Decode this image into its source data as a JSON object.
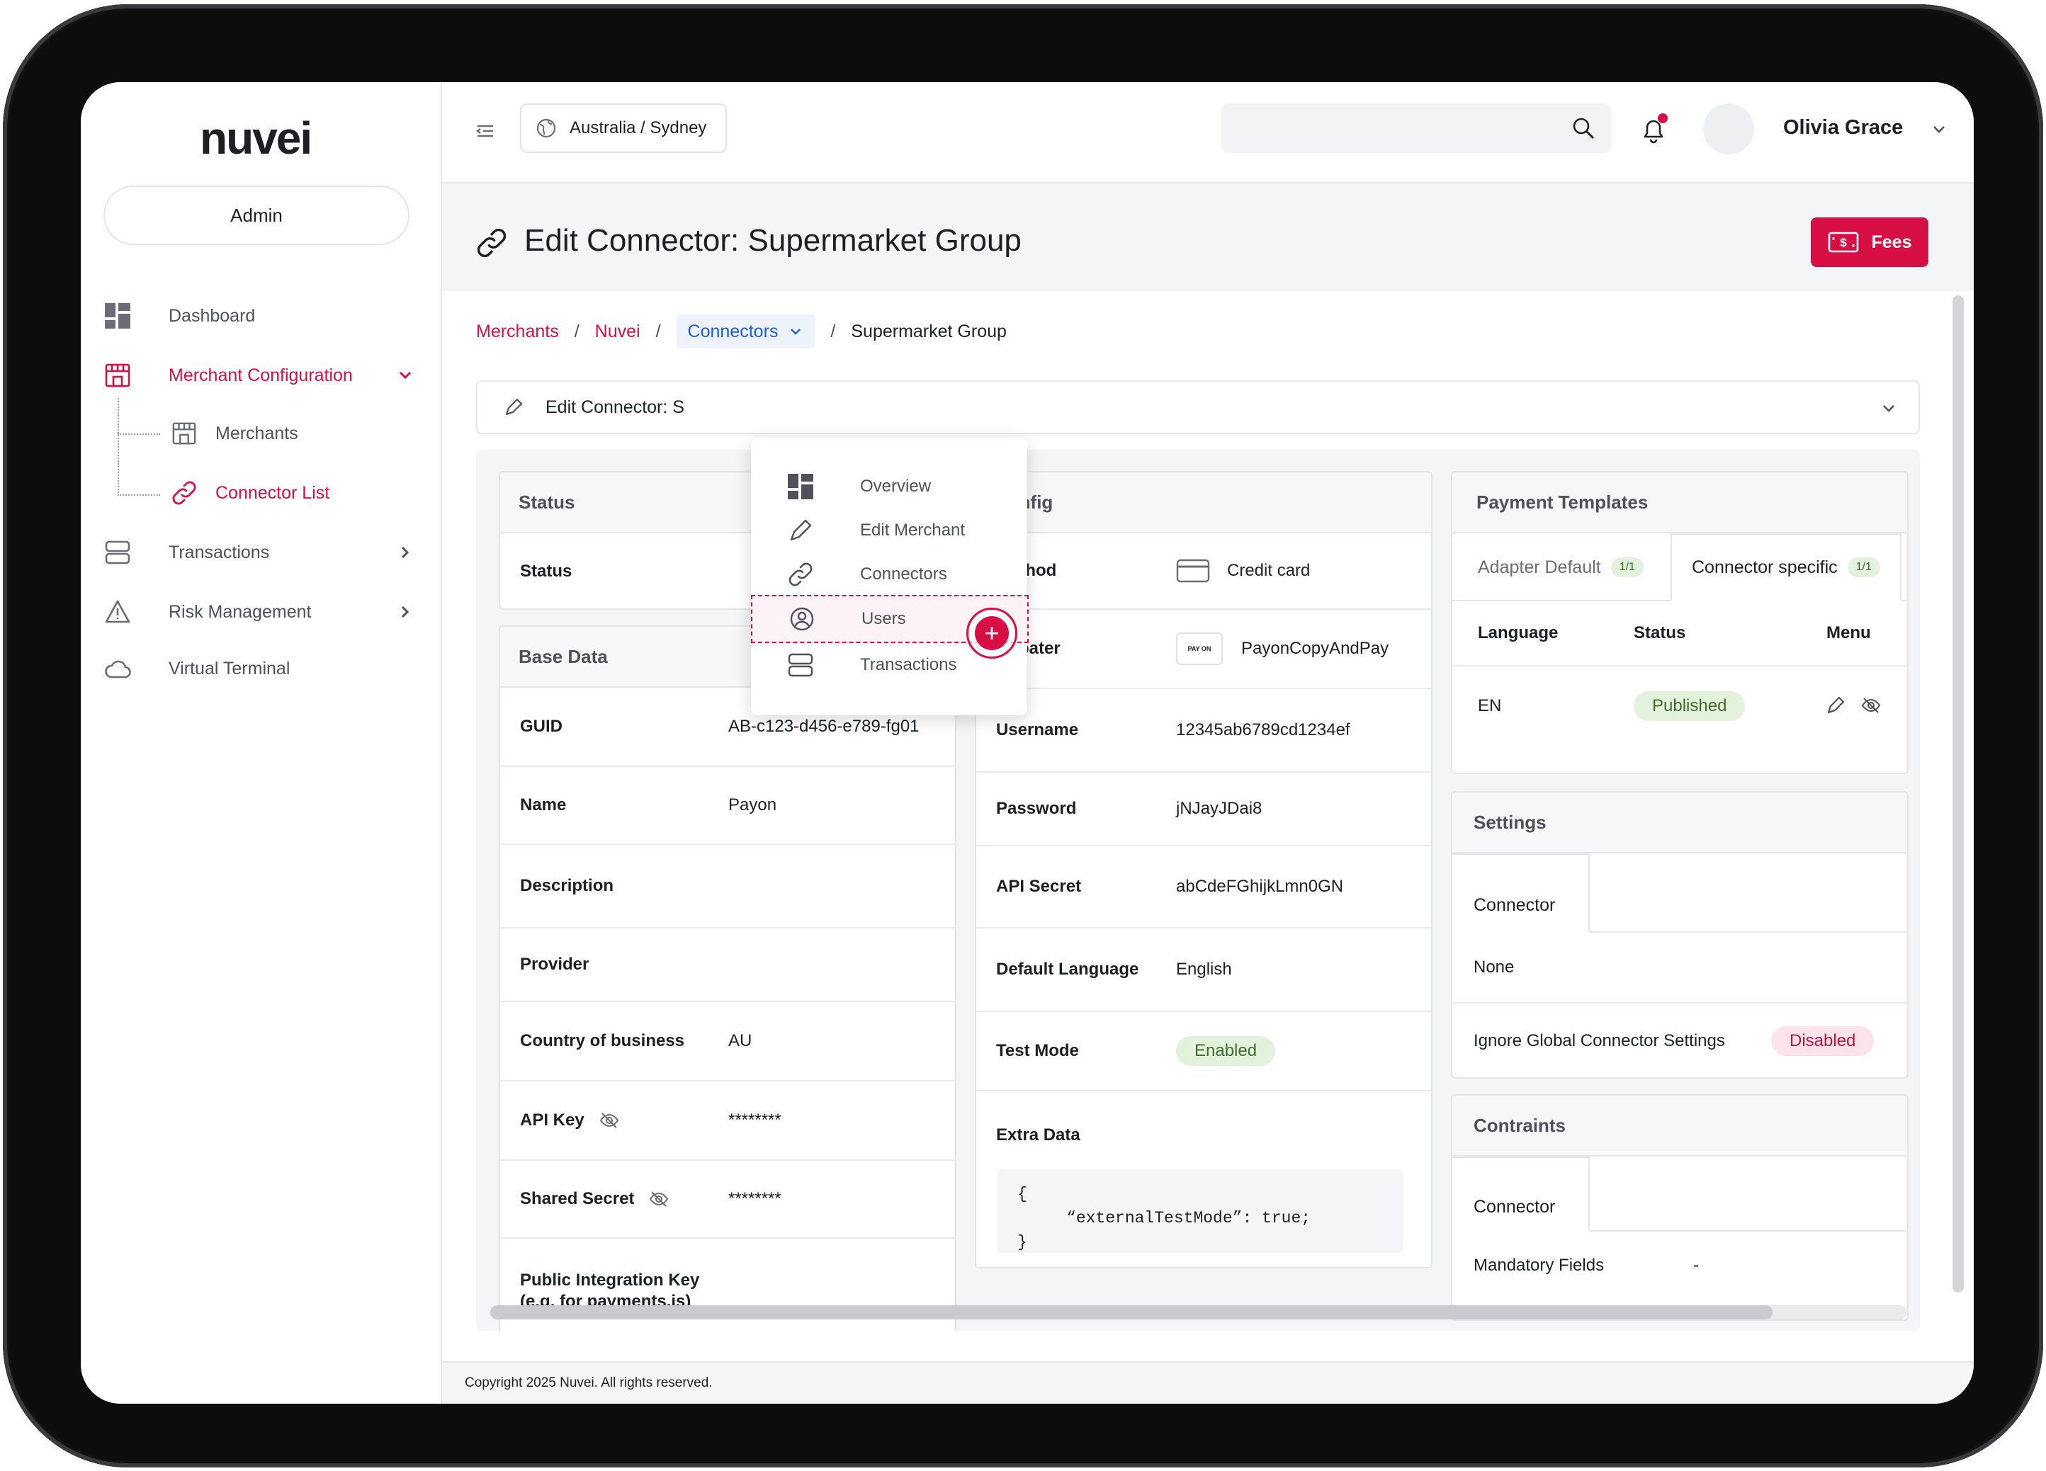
{
  "brand": {
    "logo": "nuvei",
    "accent": "#d80f45"
  },
  "sidebar": {
    "admin_label": "Admin",
    "items": [
      {
        "label": "Dashboard",
        "icon": "dashboard-icon"
      },
      {
        "label": "Merchant Configuration",
        "icon": "store-icon"
      },
      {
        "label": "Transactions",
        "icon": "layers-icon"
      },
      {
        "label": "Risk Management",
        "icon": "warning-icon"
      },
      {
        "label": "Virtual Terminal",
        "icon": "cloud-icon"
      }
    ],
    "sub_items": [
      {
        "label": "Merchants",
        "icon": "store-icon"
      },
      {
        "label": "Connector List",
        "icon": "link-icon"
      }
    ]
  },
  "topbar": {
    "timezone": "Australia / Sydney",
    "search_placeholder": "",
    "user_name": "Olivia Grace"
  },
  "page": {
    "title": "Edit Connector: Supermarket Group",
    "fees_label": "Fees"
  },
  "breadcrumb": {
    "merchants": "Merchants",
    "nuvei": "Nuvei",
    "connectors": "Connectors",
    "current": "Supermarket Group",
    "sep": "/"
  },
  "accordion": {
    "label": "Edit Connector: S"
  },
  "dropdown": {
    "items": [
      "Overview",
      "Edit Merchant",
      "Connectors",
      "Users",
      "Transactions"
    ]
  },
  "status_card": {
    "title": "Status",
    "status_label": "Status"
  },
  "base_data": {
    "title": "Base Data",
    "rows": [
      {
        "label": "GUID",
        "value": "AB-c123-d456-e789-fg01"
      },
      {
        "label": "Name",
        "value": "Payon"
      },
      {
        "label": "Description",
        "value": ""
      },
      {
        "label": "Provider",
        "value": ""
      },
      {
        "label": "Country of business",
        "value": "AU"
      },
      {
        "label": "API Key",
        "value": "********"
      },
      {
        "label": "Shared Secret",
        "value": "********"
      },
      {
        "label": "Public Integration Key",
        "value": ""
      }
    ],
    "cut_off_hint": "(e.g. for payments.js)"
  },
  "config": {
    "title": "Config",
    "rows": [
      {
        "label": "Method",
        "value": "Credit card"
      },
      {
        "label": "Adpater",
        "value": "PayonCopyAndPay",
        "logo_text": "PAY ON"
      },
      {
        "label": "Username",
        "value": "12345ab6789cd1234ef"
      },
      {
        "label": "Password",
        "value": "jNJayJDai8"
      },
      {
        "label": "API Secret",
        "value": "abCdeFGhijkLmn0GN"
      },
      {
        "label": "Default Language",
        "value": "English"
      },
      {
        "label": "Test Mode",
        "value": "Enabled"
      }
    ],
    "extra_data_label": "Extra Data",
    "extra_data_code": "{\n     “externalTestMode”: true;\n}"
  },
  "payment_templates": {
    "title": "Payment Templates",
    "tabs": [
      {
        "label": "Adapter Default",
        "badge": "1/1"
      },
      {
        "label": "Connector specific",
        "badge": "1/1"
      }
    ],
    "columns": [
      "Language",
      "Status",
      "Menu"
    ],
    "rows": [
      {
        "language": "EN",
        "status": "Published"
      }
    ]
  },
  "settings": {
    "title": "Settings",
    "tab": "Connector",
    "value": "None",
    "ignore_label": "Ignore Global Connector Settings",
    "ignore_status": "Disabled"
  },
  "constraints": {
    "title": "Contraints",
    "tab": "Connector",
    "mandatory_label": "Mandatory Fields",
    "mandatory_value": "-"
  },
  "footer": {
    "copyright": "Copyright 2025 Nuvei. All rights reserved."
  }
}
